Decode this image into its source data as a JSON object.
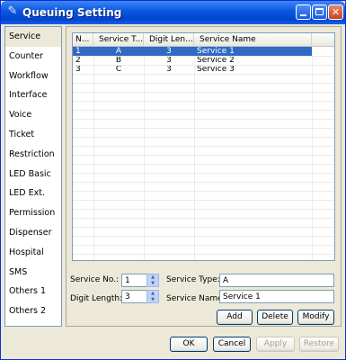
{
  "window": {
    "title": "Queuing Setting",
    "app_icon": "wrench-icon"
  },
  "nav": {
    "items": [
      "Service",
      "Counter",
      "Workflow",
      "Interface",
      "Voice",
      "Ticket",
      "Restriction",
      "LED Basic",
      "LED Ext.",
      "Permission",
      "Dispenser",
      "Hospital",
      "SMS",
      "Others 1",
      "Others 2"
    ],
    "selected": "Service"
  },
  "table": {
    "columns": [
      "N...",
      "Service T...",
      "Digit Len...",
      "Service Name"
    ],
    "rows": [
      [
        "1",
        "A",
        "3",
        "Service 1"
      ],
      [
        "2",
        "B",
        "3",
        "Service 2"
      ],
      [
        "3",
        "C",
        "3",
        "Service 3"
      ]
    ],
    "selected_row": 0
  },
  "form": {
    "service_no_label": "Service No.:",
    "service_no_value": "1",
    "digit_length_label": "Digit Length:",
    "digit_length_value": "3",
    "service_type_label": "Service Type:",
    "service_type_value": "A",
    "service_name_label": "Service Name:",
    "service_name_value": "Service 1"
  },
  "actions": {
    "add": "Add",
    "delete": "Delete",
    "modify": "Modify"
  },
  "footer": {
    "ok": "OK",
    "cancel": "Cancel",
    "apply": "Apply",
    "restore": "Restore"
  }
}
